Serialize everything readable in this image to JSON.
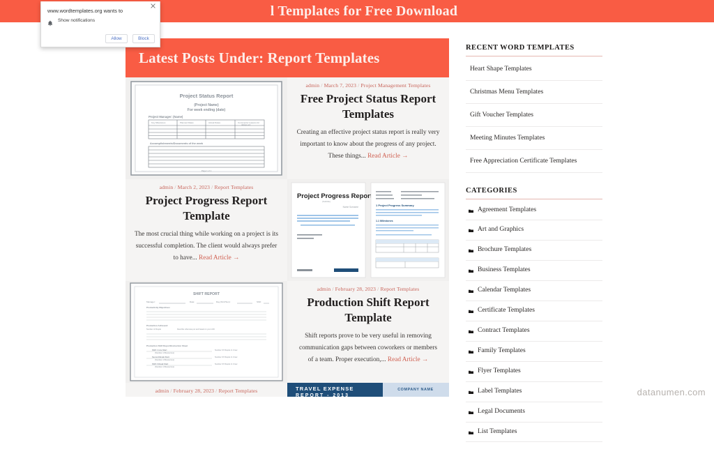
{
  "header": {
    "title": "l Templates for Free Download"
  },
  "archive": {
    "title": "Latest Posts Under: Report Templates"
  },
  "notification_dialog": {
    "origin": "www.wordtemplates.org wants to",
    "permission": "Show notifications",
    "bell_icon": "bell-icon",
    "close_icon": "close-icon",
    "allow_label": "Allow",
    "block_label": "Block"
  },
  "posts": [
    {
      "author": "admin",
      "date": "March 7, 2023",
      "category": "Project Management Templates",
      "title": "Free Project Status Report Templates",
      "excerpt": "Creating an effective project status report is really very important to know about the progress of any project. These things...",
      "read_more": "Read Article →",
      "thumb_title": "Project Status Report",
      "thumb_sub1": "(Project Name)",
      "thumb_sub2": "For week ending (date)"
    },
    {
      "author": "admin",
      "date": "March 2, 2023",
      "category": "Report Templates",
      "title": "Project Progress Report Template",
      "excerpt": "The most crucial thing while working on a project is its successful completion. The client would always prefer to have...",
      "read_more": "Read Article →",
      "thumb_title": "Project Progress Report",
      "thumb_sub1": "Project Progress Summary"
    },
    {
      "author": "admin",
      "date": "February 28, 2023",
      "category": "Report Templates",
      "title": "Production Shift Report Template",
      "excerpt": "Shift reports prove to be very useful in removing communication gaps between coworkers or members of a team. Proper execution,...",
      "read_more": "Read Article →",
      "thumb_title": "SHIFT REPORT"
    },
    {
      "author": "admin",
      "date": "February 28, 2023",
      "category": "Report Templates",
      "thumb_title": "TRAVEL EXPENSE",
      "thumb_sub1": "REPORT - 2013",
      "thumb_sub2": "COMPANY NAME"
    }
  ],
  "sidebar": {
    "recent": {
      "title": "RECENT WORD TEMPLATES",
      "items": [
        "Heart Shape Templates",
        "Christmas Menu Templates",
        "Gift Voucher Templates",
        "Meeting Minutes Templates",
        "Free Appreciation Certificate Templates"
      ]
    },
    "categories": {
      "title": "CATEGORIES",
      "icon": "folder-icon",
      "items": [
        "Agreement Templates",
        "Art and Graphics",
        "Brochure Templates",
        "Business Templates",
        "Calendar Templates",
        "Certificate Templates",
        "Contract Templates",
        "Family Templates",
        "Flyer Templates",
        "Label Templates",
        "Legal Documents",
        "List Templates"
      ]
    }
  },
  "watermark": "datanumen.com",
  "colors": {
    "accent": "#f95c44",
    "header_text": "#fdeeea",
    "meta_text": "#c8645a",
    "link": "#d06152",
    "post_bg": "#f5f4f3"
  }
}
